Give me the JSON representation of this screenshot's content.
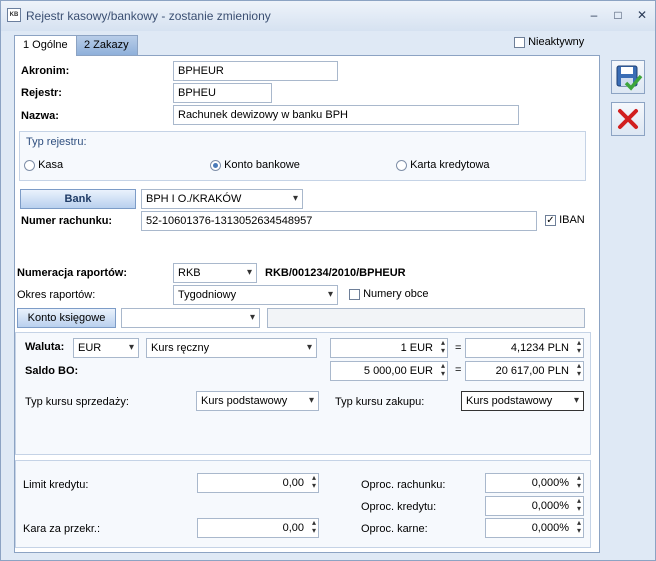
{
  "window": {
    "title": "Rejestr kasowy/bankowy - zostanie zmieniony",
    "icon": "KB",
    "min": "–",
    "max": "□",
    "close": "✕"
  },
  "tabs": [
    {
      "label": "1 Ogólne"
    },
    {
      "label": "2 Zakazy"
    }
  ],
  "inactive": {
    "label": "Nieaktywny",
    "checked": false
  },
  "akronim": {
    "label": "Akronim:",
    "value": "BPHEUR"
  },
  "rejestr": {
    "label": "Rejestr:",
    "value": "BPHEU"
  },
  "nazwa": {
    "label": "Nazwa:",
    "value": "Rachunek dewizowy w banku BPH"
  },
  "typ_rejestru": {
    "label": "Typ rejestru:",
    "options": [
      {
        "label": "Kasa",
        "selected": false
      },
      {
        "label": "Konto bankowe",
        "selected": true
      },
      {
        "label": "Karta kredytowa",
        "selected": false
      }
    ]
  },
  "bank": {
    "button": "Bank",
    "value": "BPH I O./KRAKÓW"
  },
  "numer_rachunku": {
    "label": "Numer rachunku:",
    "value": "52-10601376-1313052634548957",
    "iban_label": "IBAN",
    "iban_checked": true
  },
  "numeracja": {
    "label": "Numeracja raportów:",
    "value": "RKB",
    "preview": "RKB/001234/2010/BPHEUR"
  },
  "okres": {
    "label": "Okres raportów:",
    "value": "Tygodniowy",
    "numery_obce": "Numery obce",
    "numery_obce_checked": false
  },
  "konto": {
    "button": "Konto księgowe",
    "value": "",
    "desc": ""
  },
  "waluta": {
    "label": "Waluta:",
    "value": "EUR",
    "kurs": "Kurs ręczny",
    "amount": "1 EUR",
    "eq": "=",
    "rate": "4,1234 PLN"
  },
  "saldo": {
    "label": "Saldo BO:",
    "amount": "5 000,00 EUR",
    "eq": "=",
    "pln": "20 617,00 PLN"
  },
  "kurs_sprzedazy": {
    "label": "Typ kursu sprzedaży:",
    "value": "Kurs podstawowy"
  },
  "kurs_zakupu": {
    "label": "Typ kursu zakupu:",
    "value": "Kurs podstawowy"
  },
  "limit": {
    "label": "Limit kredytu:",
    "value": "0,00"
  },
  "kara": {
    "label": "Kara za przekr.:",
    "value": "0,00"
  },
  "oproc_rachunku": {
    "label": "Oproc. rachunku:",
    "value": "0,000%"
  },
  "oproc_kredytu": {
    "label": "Oproc. kredytu:",
    "value": "0,000%"
  },
  "oproc_karne": {
    "label": "Oproc. karne:",
    "value": "0,000%"
  },
  "side": {
    "save_icon": "save-icon",
    "cancel_icon": "cancel-icon"
  }
}
